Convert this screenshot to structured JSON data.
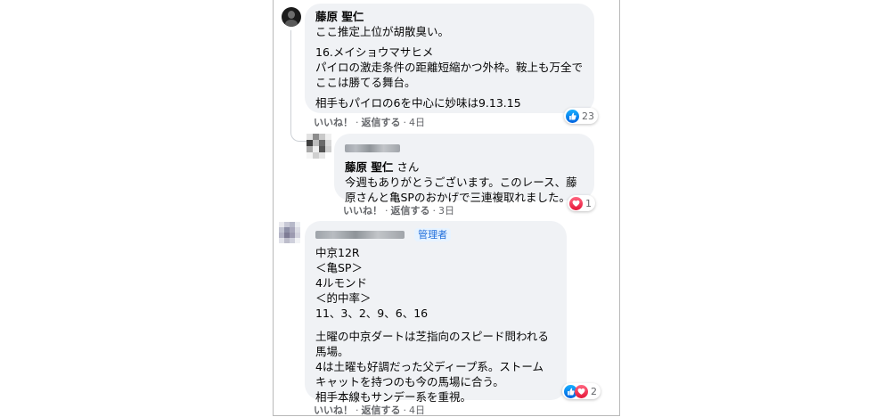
{
  "comments": [
    {
      "author": "藤原 聖仁",
      "paragraphs": [
        "ここ推定上位が胡散臭い。",
        "16.メイショウマサヒメ\nパイロの激走条件の距離短縮かつ外枠。鞍上も万全で\nここは勝てる舞台。",
        "相手もパイロの6を中心に妙味は9.13.15"
      ],
      "reaction_count": "23",
      "reaction_icons": [
        "like-icon"
      ],
      "like_label": "いいね！",
      "reply_label": "返信する",
      "time": "4日"
    },
    {
      "author": "",
      "mention": "藤原 聖仁",
      "mention_suffix": " さん",
      "paragraphs": [
        "今週もありがとうございます。このレース、藤\n原さんと亀SPのおかげで三連複取れました。"
      ],
      "reaction_count": "1",
      "reaction_icons": [
        "love-icon"
      ],
      "like_label": "いいね！",
      "reply_label": "返信する",
      "time": "3日"
    },
    {
      "author": "",
      "badge": "管理者",
      "paragraphs": [
        "中京12R\n＜亀SP＞\n4ルモンド\n＜的中率＞\n11、3、2、9、6、16",
        "土曜の中京ダートは芝指向のスピード問われる\n馬場。\n4は土曜も好調だった父ディープ系。ストーム\nキャットを持つのも今の馬場に合う。\n相手本線もサンデー系を重視。"
      ],
      "reaction_count": "2",
      "reaction_icons": [
        "like-icon",
        "love-icon"
      ],
      "like_label": "いいね！",
      "reply_label": "返信する",
      "time": "4日"
    }
  ],
  "colors": {
    "bubble": "#f0f2f5",
    "meta": "#65676b",
    "like": "#0866ff",
    "love": "#e61739",
    "admin_badge": "#216fdb"
  }
}
